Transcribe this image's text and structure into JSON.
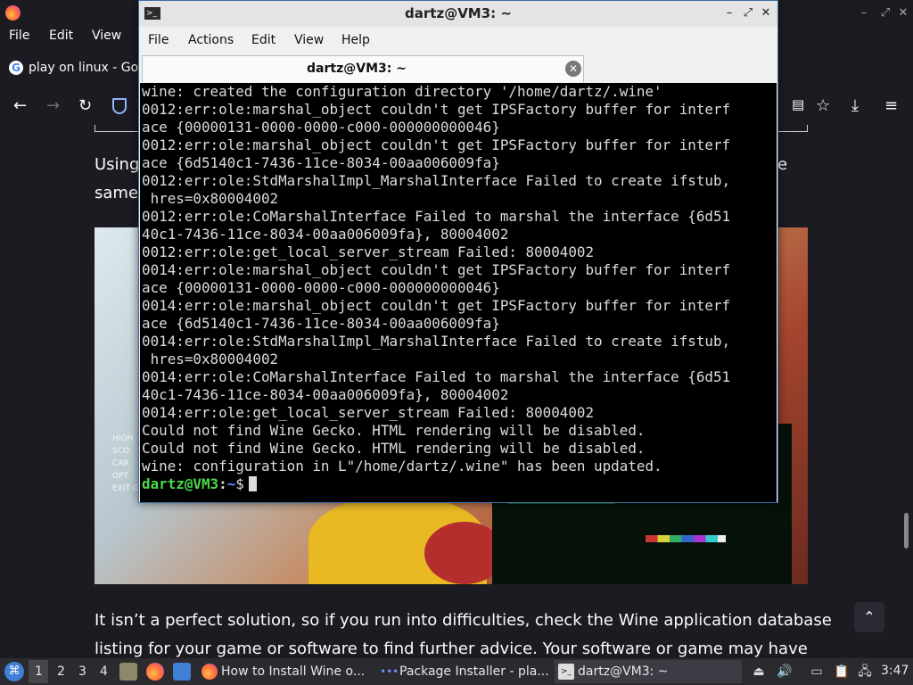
{
  "browser": {
    "menu": [
      "File",
      "Edit",
      "View"
    ],
    "tab_title": "play on linux - Goo",
    "page": {
      "line1_left": "Using",
      "line1_right": "e",
      "line2_left": "same",
      "image_menu": [
        "HIGH",
        "SCO",
        "CAR",
        "OPT",
        "EXIT GAME"
      ],
      "para1": "It isn’t a perfect solution, so if you run into difficulties, check the Wine application database",
      "para2": "listing for your game or software to find further advice. Your software or game may have"
    }
  },
  "terminal": {
    "window_title": "dartz@VM3: ~",
    "menu": [
      "File",
      "Actions",
      "Edit",
      "View",
      "Help"
    ],
    "tab_label": "dartz@VM3: ~",
    "output_lines": [
      "wine: created the configuration directory '/home/dartz/.wine'",
      "0012:err:ole:marshal_object couldn't get IPSFactory buffer for interf",
      "ace {00000131-0000-0000-c000-000000000046}",
      "0012:err:ole:marshal_object couldn't get IPSFactory buffer for interf",
      "ace {6d5140c1-7436-11ce-8034-00aa006009fa}",
      "0012:err:ole:StdMarshalImpl_MarshalInterface Failed to create ifstub,",
      " hres=0x80004002",
      "0012:err:ole:CoMarshalInterface Failed to marshal the interface {6d51",
      "40c1-7436-11ce-8034-00aa006009fa}, 80004002",
      "0012:err:ole:get_local_server_stream Failed: 80004002",
      "0014:err:ole:marshal_object couldn't get IPSFactory buffer for interf",
      "ace {00000131-0000-0000-c000-000000000046}",
      "0014:err:ole:marshal_object couldn't get IPSFactory buffer for interf",
      "ace {6d5140c1-7436-11ce-8034-00aa006009fa}",
      "0014:err:ole:StdMarshalImpl_MarshalInterface Failed to create ifstub,",
      " hres=0x80004002",
      "0014:err:ole:CoMarshalInterface Failed to marshal the interface {6d51",
      "40c1-7436-11ce-8034-00aa006009fa}, 80004002",
      "0014:err:ole:get_local_server_stream Failed: 80004002",
      "Could not find Wine Gecko. HTML rendering will be disabled.",
      "Could not find Wine Gecko. HTML rendering will be disabled.",
      "wine: configuration in L\"/home/dartz/.wine\" has been updated."
    ],
    "prompt_user": "dartz@VM3",
    "prompt_sep": ":",
    "prompt_path": "~",
    "prompt_symbol": "$"
  },
  "taskbar": {
    "workspaces": [
      "1",
      "2",
      "3",
      "4"
    ],
    "tasks": [
      {
        "label": "How to Install Wine o..."
      },
      {
        "label": "Package Installer - pla..."
      },
      {
        "label": "dartz@VM3: ~"
      }
    ],
    "clock": "3:47"
  },
  "colors": {
    "prompt_user": "#4bd84b",
    "prompt_path": "#5b8cff",
    "terminal_bg": "#000000",
    "page_bg": "#1c1b22"
  }
}
